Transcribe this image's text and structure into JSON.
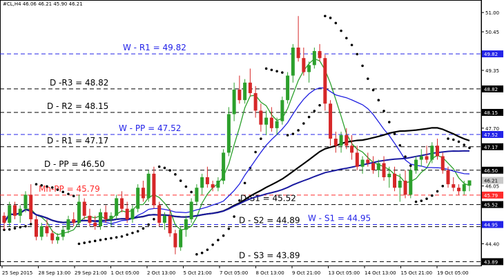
{
  "colors": {
    "background": "#ffffff",
    "bull": "#2ca02c",
    "bear": "#d62728",
    "sar": "#000000",
    "ma_fast": "#2ca02c",
    "ma_mid": "#1f1fe0",
    "ma_slow": "#000000",
    "ma_long": "#1a1aa0",
    "pivot_black": "#000000",
    "pivot_blue": "#2323e8",
    "pivot_red": "#ff2a2a",
    "axis_text": "#000000"
  },
  "chart_data": {
    "type": "candlestick",
    "title": "#CL,H4  46.06 46.21 45.90 46.21",
    "ylim": [
      43.78,
      51.2
    ],
    "price_axis": [
      "51.00",
      "50.45",
      "49.82",
      "49.35",
      "48.82",
      "48.15",
      "47.70",
      "47.52",
      "47.17",
      "46.50",
      "46.21",
      "46.05",
      "45.79",
      "45.52",
      "44.95",
      "44.40",
      "43.89"
    ],
    "time_axis": [
      "25 Sep 2015",
      "28 Sep 13:00",
      "29 Sep 21:00",
      "1 Oct 05:00",
      "2 Oct 13:00",
      "5 Oct 21:00",
      "7 Oct 05:00",
      "8 Oct 13:00",
      "9 Oct 21:00",
      "13 Oct 05:00",
      "14 Oct 13:00",
      "15 Oct 21:00",
      "19 Oct 05:00"
    ],
    "last_price": "46.21",
    "levels": [
      {
        "name": "W - R1 = 49.82",
        "value": 49.82,
        "color": "blue",
        "dash": "long"
      },
      {
        "name": "D -R3 = 48.82",
        "value": 48.82,
        "color": "black",
        "dash": "long"
      },
      {
        "name": "D - R2 = 48.15",
        "value": 48.15,
        "color": "black",
        "dash": "long"
      },
      {
        "name": "W - PP = 47.52",
        "value": 47.52,
        "color": "blue",
        "dash": "long"
      },
      {
        "name": "D - R1 = 47.17",
        "value": 47.17,
        "color": "black",
        "dash": "long"
      },
      {
        "name": "D - PP = 46.50",
        "value": 46.5,
        "color": "black",
        "dash": "long"
      },
      {
        "name": "Mn-PP = 45.79",
        "value": 45.79,
        "color": "red",
        "dash": "long"
      },
      {
        "name": "D-S1 = 45.52",
        "value": 45.52,
        "color": "black",
        "dash": "long"
      },
      {
        "name": "W - S1 = 44.95",
        "value": 44.95,
        "color": "blue",
        "dash": "long"
      },
      {
        "name": "D - S2 = 44.89",
        "value": 44.89,
        "color": "black",
        "dash": "long"
      },
      {
        "name": "D - S3 = 43.89",
        "value": 43.89,
        "color": "black",
        "dash": "long"
      }
    ],
    "candles": [
      [
        45.2,
        45.3,
        44.8,
        45.0
      ],
      [
        45.0,
        45.6,
        44.9,
        45.5
      ],
      [
        45.5,
        45.6,
        45.1,
        45.2
      ],
      [
        45.2,
        45.5,
        45.0,
        45.4
      ],
      [
        45.4,
        45.9,
        45.3,
        45.8
      ],
      [
        45.8,
        46.1,
        45.0,
        45.1
      ],
      [
        45.1,
        45.2,
        44.5,
        44.6
      ],
      [
        44.6,
        45.0,
        44.5,
        44.9
      ],
      [
        44.9,
        45.1,
        44.6,
        44.7
      ],
      [
        44.7,
        44.8,
        44.4,
        44.5
      ],
      [
        44.5,
        44.7,
        44.4,
        44.6
      ],
      [
        44.6,
        44.9,
        44.5,
        44.8
      ],
      [
        44.8,
        45.2,
        44.7,
        45.1
      ],
      [
        45.1,
        45.3,
        44.9,
        45.0
      ],
      [
        45.0,
        45.8,
        44.9,
        45.6
      ],
      [
        45.6,
        45.7,
        45.1,
        45.2
      ],
      [
        45.2,
        45.4,
        44.9,
        45.0
      ],
      [
        45.0,
        45.2,
        44.8,
        44.9
      ],
      [
        44.9,
        45.4,
        44.8,
        45.3
      ],
      [
        45.3,
        45.5,
        45.0,
        45.1
      ],
      [
        45.1,
        45.3,
        44.9,
        45.2
      ],
      [
        45.2,
        45.8,
        45.1,
        45.7
      ],
      [
        45.7,
        45.9,
        45.3,
        45.4
      ],
      [
        45.4,
        45.6,
        45.0,
        45.1
      ],
      [
        45.1,
        45.5,
        45.0,
        45.4
      ],
      [
        45.4,
        46.1,
        45.3,
        46.0
      ],
      [
        46.0,
        46.2,
        45.6,
        45.7
      ],
      [
        45.7,
        46.5,
        45.6,
        46.4
      ],
      [
        46.4,
        46.6,
        45.4,
        45.5
      ],
      [
        45.5,
        45.6,
        44.9,
        45.0
      ],
      [
        45.0,
        45.3,
        44.8,
        45.2
      ],
      [
        45.2,
        45.4,
        44.6,
        44.7
      ],
      [
        44.7,
        44.8,
        44.1,
        44.3
      ],
      [
        44.3,
        44.9,
        44.2,
        44.8
      ],
      [
        44.8,
        45.2,
        44.6,
        45.1
      ],
      [
        45.1,
        45.7,
        45.0,
        45.6
      ],
      [
        45.6,
        46.1,
        45.5,
        46.0
      ],
      [
        46.0,
        46.4,
        45.8,
        46.3
      ],
      [
        46.3,
        46.6,
        46.0,
        46.1
      ],
      [
        46.1,
        46.2,
        45.9,
        46.0
      ],
      [
        46.0,
        46.3,
        45.9,
        46.2
      ],
      [
        46.2,
        47.1,
        46.1,
        47.0
      ],
      [
        47.0,
        48.3,
        46.9,
        48.1
      ],
      [
        48.1,
        49.0,
        47.9,
        48.8
      ],
      [
        48.8,
        49.2,
        48.4,
        48.5
      ],
      [
        48.5,
        49.1,
        48.4,
        49.0
      ],
      [
        49.0,
        49.4,
        48.6,
        48.7
      ],
      [
        48.7,
        48.9,
        48.0,
        48.2
      ],
      [
        48.2,
        48.4,
        47.6,
        47.8
      ],
      [
        47.8,
        48.2,
        47.5,
        48.0
      ],
      [
        48.0,
        48.3,
        47.6,
        47.7
      ],
      [
        47.7,
        48.0,
        47.5,
        47.9
      ],
      [
        47.9,
        48.6,
        47.8,
        48.5
      ],
      [
        48.5,
        49.3,
        48.4,
        49.2
      ],
      [
        49.2,
        50.1,
        49.0,
        50.0
      ],
      [
        50.0,
        50.9,
        49.6,
        49.7
      ],
      [
        49.7,
        50.0,
        49.2,
        49.3
      ],
      [
        49.3,
        49.6,
        49.0,
        49.5
      ],
      [
        49.5,
        50.0,
        49.4,
        49.9
      ],
      [
        49.9,
        50.1,
        49.6,
        49.7
      ],
      [
        49.7,
        49.8,
        48.2,
        48.4
      ],
      [
        48.4,
        48.5,
        47.2,
        47.4
      ],
      [
        47.4,
        47.6,
        47.0,
        47.2
      ],
      [
        47.2,
        47.6,
        47.0,
        47.5
      ],
      [
        47.5,
        47.7,
        47.1,
        47.2
      ],
      [
        47.2,
        47.5,
        46.8,
        47.0
      ],
      [
        47.0,
        47.2,
        46.5,
        46.6
      ],
      [
        46.6,
        46.9,
        46.4,
        46.8
      ],
      [
        46.8,
        47.0,
        46.6,
        46.7
      ],
      [
        46.7,
        46.9,
        46.4,
        46.5
      ],
      [
        46.5,
        46.8,
        46.3,
        46.7
      ],
      [
        46.7,
        46.9,
        46.2,
        46.3
      ],
      [
        46.3,
        46.6,
        46.0,
        46.4
      ],
      [
        46.4,
        46.6,
        45.9,
        46.0
      ],
      [
        46.0,
        46.4,
        45.6,
        46.2
      ],
      [
        46.2,
        46.5,
        45.7,
        45.8
      ],
      [
        45.8,
        46.6,
        45.7,
        46.5
      ],
      [
        46.5,
        46.9,
        46.4,
        46.8
      ],
      [
        46.8,
        47.1,
        46.6,
        46.9
      ],
      [
        46.9,
        47.2,
        46.7,
        46.8
      ],
      [
        46.8,
        47.3,
        46.7,
        47.2
      ],
      [
        47.2,
        47.4,
        46.8,
        46.9
      ],
      [
        46.9,
        47.0,
        46.4,
        46.5
      ],
      [
        46.5,
        46.6,
        46.0,
        46.1
      ],
      [
        46.1,
        46.3,
        45.9,
        46.0
      ],
      [
        46.0,
        46.1,
        45.8,
        45.9
      ],
      [
        45.9,
        46.2,
        45.8,
        46.1
      ],
      [
        46.06,
        46.21,
        45.9,
        46.21
      ]
    ]
  }
}
